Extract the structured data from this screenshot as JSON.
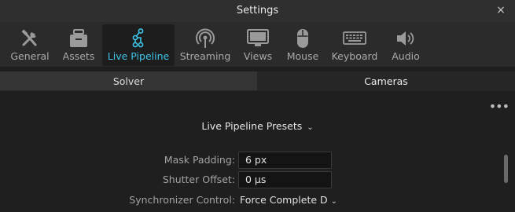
{
  "window": {
    "title": "Settings",
    "close_glyph": "×"
  },
  "toolbar": {
    "items": [
      {
        "label": "General",
        "icon": "tools-icon",
        "active": false
      },
      {
        "label": "Assets",
        "icon": "box-icon",
        "active": false
      },
      {
        "label": "Live Pipeline",
        "icon": "pipeline-icon",
        "active": true
      },
      {
        "label": "Streaming",
        "icon": "broadcast-icon",
        "active": false
      },
      {
        "label": "Views",
        "icon": "monitor-icon",
        "active": false
      },
      {
        "label": "Mouse",
        "icon": "mouse-icon",
        "active": false
      },
      {
        "label": "Keyboard",
        "icon": "keyboard-icon",
        "active": false
      },
      {
        "label": "Audio",
        "icon": "speaker-icon",
        "active": false
      }
    ]
  },
  "subtabs": [
    {
      "label": "Solver",
      "selected": false
    },
    {
      "label": "Cameras",
      "selected": true
    }
  ],
  "content": {
    "more_glyph": "•••",
    "presets_label": "Live Pipeline Presets",
    "fields": {
      "mask_padding": {
        "label": "Mask Padding:",
        "value": "6 px"
      },
      "shutter_offset": {
        "label": "Shutter Offset:",
        "value": "0 µs"
      },
      "sync_control": {
        "label": "Synchronizer Control:",
        "value": "Force Complete D"
      }
    }
  },
  "colors": {
    "accent": "#3fc3e8",
    "icon": "#9a9a9a"
  }
}
